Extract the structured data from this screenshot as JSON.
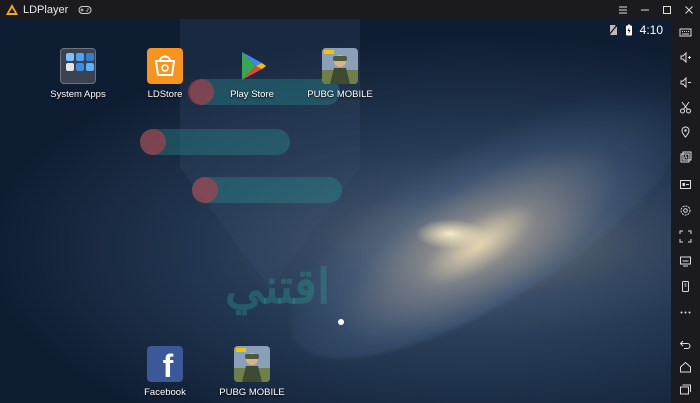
{
  "window": {
    "title": "LDPlayer"
  },
  "status_bar": {
    "time": "4:10"
  },
  "home": {
    "apps_top": [
      {
        "label": "System Apps",
        "icon": "system-apps-icon"
      },
      {
        "label": "LDStore",
        "icon": "ldstore-icon"
      },
      {
        "label": "Play Store",
        "icon": "play-store-icon"
      },
      {
        "label": "PUBG MOBILE",
        "icon": "pubg-icon"
      }
    ],
    "dock": [
      {
        "label": "Facebook",
        "icon": "facebook-icon"
      },
      {
        "label": "PUBG MOBILE",
        "icon": "pubg-icon"
      }
    ]
  },
  "watermark_text": "اقتني",
  "toolbar": [
    "keyboard-icon",
    "volume-up-icon",
    "volume-down-icon",
    "scissors-icon",
    "location-icon",
    "apk-install-icon",
    "operation-record-icon",
    "settings-icon",
    "fullscreen-icon",
    "screenshot-icon",
    "shake-icon",
    "more-icon",
    "back-icon",
    "home-icon",
    "recent-apps-icon"
  ],
  "colors": {
    "titlebar": "#1b1b1f",
    "ldstore": "#f7941d",
    "facebook": "#3b5998"
  }
}
